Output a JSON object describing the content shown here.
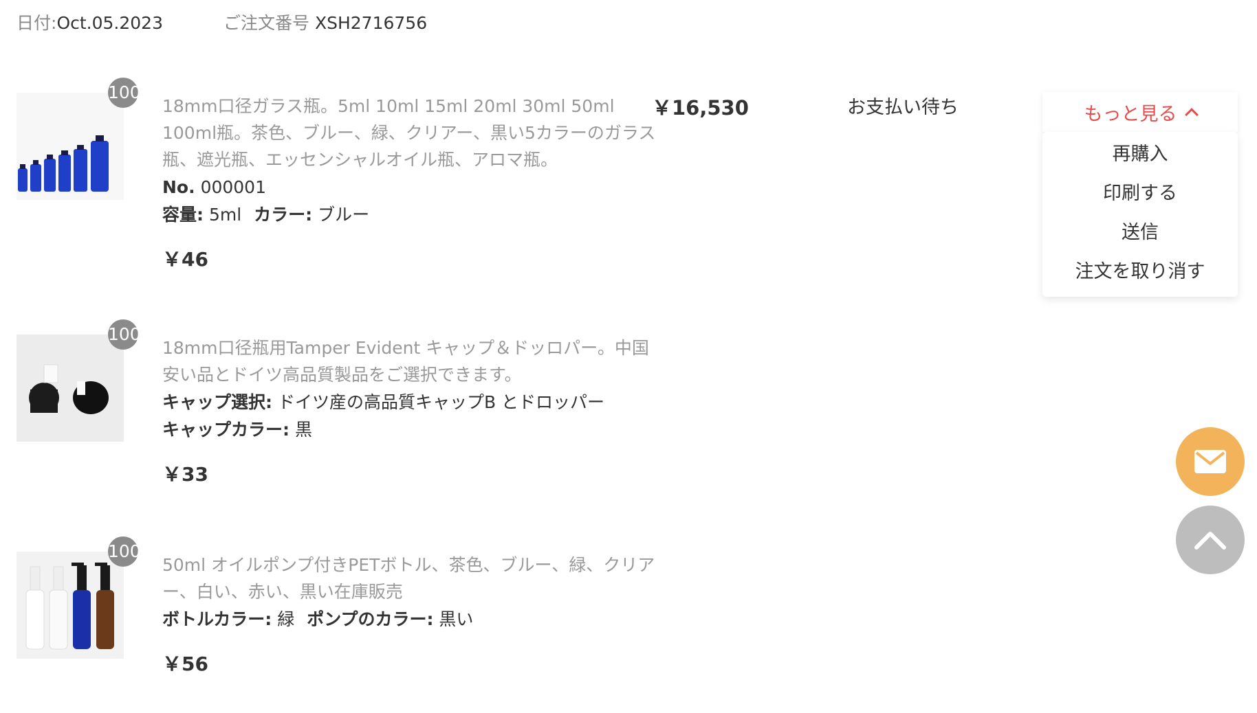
{
  "order": {
    "date_label": "日付:",
    "date_value": "Oct.05.2023",
    "number_label": "ご注文番号",
    "number_value": "XSH2716756",
    "total": "￥16,530",
    "status": "お支払い待ち"
  },
  "more_menu": {
    "label": "もっと見る",
    "items": [
      "再購入",
      "印刷する",
      "送信",
      "注文を取り消す"
    ]
  },
  "items": [
    {
      "qty": "100",
      "title": "18mm口径ガラス瓶。5ml 10ml 15ml 20ml 30ml 50ml 100ml瓶。茶色、ブルー、緑、クリアー、黒い5カラーのガラス瓶、遮光瓶、エッセンシャルオイル瓶、アロマ瓶。",
      "no_label": "No.",
      "no_value": "000001",
      "spec1_label": "容量:",
      "spec1_value": "5ml",
      "spec2_label": "カラー:",
      "spec2_value": "ブルー",
      "price": "￥46"
    },
    {
      "qty": "100",
      "title": "18mm口径瓶用Tamper Evident キャップ＆ドッロパー。中国安い品とドイツ高品質製品をご選択できます。",
      "spec1_label": "キャップ選択:",
      "spec1_value": "ドイツ産の高品質キャップB とドロッパー",
      "spec2_label": "キャップカラー:",
      "spec2_value": "黒",
      "price": "￥33"
    },
    {
      "qty": "100",
      "title": "50ml オイルポンプ付きPETボトル、茶色、ブルー、緑、クリアー、白い、赤い、黒い在庫販売",
      "spec1_label": "ボトルカラー:",
      "spec1_value": "緑",
      "spec2_label": "ポンプのカラー:",
      "spec2_value": "黒い",
      "price": "￥56"
    }
  ],
  "icons": {
    "mail": "mail-icon",
    "scroll_top": "chevron-up-icon"
  },
  "colors": {
    "accent_red": "#e84b4b",
    "mail_fab": "#f2b35a",
    "top_fab": "#bdbdbd"
  }
}
